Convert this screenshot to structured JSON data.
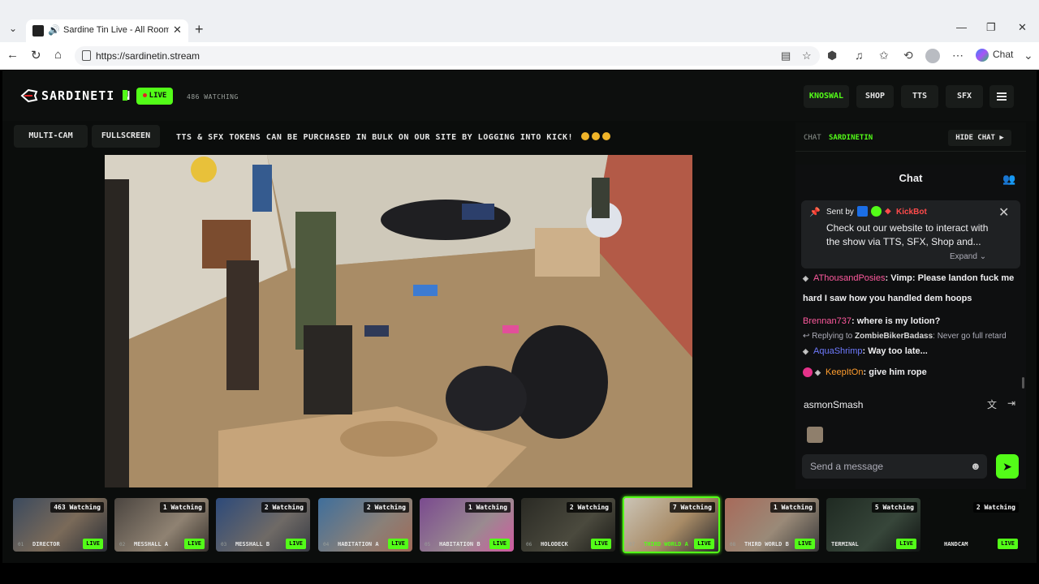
{
  "browser": {
    "tab_title": "Sardine Tin Live - All Rooms, /",
    "url": "https://sardinetin.stream",
    "chat_label": "Chat"
  },
  "header": {
    "logo_text": "SARDINETI N",
    "live_label": "LIVE",
    "watching": "486 WATCHING",
    "buttons": [
      "KNOSWAL",
      "SHOP",
      "TTS",
      "SFX"
    ]
  },
  "toolbar": {
    "multi_cam": "MULTI-CAM",
    "fullscreen": "FULLSCREEN",
    "ticker": "TTS & SFX TOKENS CAN BE PURCHASED IN BULK ON OUR SITE BY LOGGING INTO KICK!"
  },
  "chat": {
    "strip_label": "CHAT",
    "strip_channel": "SARDINETIN",
    "hide_chat": "HIDE CHAT ▶",
    "title": "Chat",
    "pinned": {
      "sent_by": "Sent by",
      "bot_name": "KickBot",
      "text": "Check out our website to interact with the show via TTS, SFX, Shop and...",
      "expand": "Expand"
    },
    "messages": [
      {
        "user": "AThousandPosies",
        "color": "#ff5a9e",
        "text": "Vimp: Please landon fuck me hard I saw how you handled dem hoops"
      },
      {
        "user": "Brennan737",
        "color": "#ff5a9e",
        "text": "where is my lotion?"
      },
      {
        "user": "AquaShrimp",
        "color": "#6f7bff",
        "text": "Way too late..."
      },
      {
        "user": "KeepItOn",
        "color": "#ff9d2e",
        "text": "give him rope"
      }
    ],
    "reply": {
      "prefix": "Replying to",
      "user": "ZombieBikerBadass",
      "text": "Never go full retard"
    },
    "mention": "asmonSmash",
    "input_placeholder": "Send a message"
  },
  "cameras": [
    {
      "num": "01",
      "name": "DIRECTOR",
      "watching": "463 Watching",
      "live": "LIVE",
      "active": false
    },
    {
      "num": "02",
      "name": "MESSHALL A",
      "watching": "1 Watching",
      "live": "LIVE",
      "active": false
    },
    {
      "num": "03",
      "name": "MESSHALL B",
      "watching": "2 Watching",
      "live": "LIVE",
      "active": false
    },
    {
      "num": "04",
      "name": "HABITATION A",
      "watching": "2 Watching",
      "live": "LIVE",
      "active": false
    },
    {
      "num": "05",
      "name": "HABITATION B",
      "watching": "1 Watching",
      "live": "LIVE",
      "active": false
    },
    {
      "num": "06",
      "name": "HOLODECK",
      "watching": "2 Watching",
      "live": "LIVE",
      "active": false
    },
    {
      "num": "07",
      "name": "THIRD WORLD A",
      "watching": "7 Watching",
      "live": "LIVE",
      "active": true
    },
    {
      "num": "08",
      "name": "THIRD WORLD B",
      "watching": "1 Watching",
      "live": "LIVE",
      "active": false
    },
    {
      "num": "",
      "name": "TERMINAL",
      "watching": "5 Watching",
      "live": "LIVE",
      "active": false
    },
    {
      "num": "",
      "name": "HANDCAM",
      "watching": "2 Watching",
      "live": "LIVE",
      "active": false
    }
  ],
  "colors": {
    "accent": "#53fc18",
    "background": "#0b0d0c",
    "bot_red": "#ff4b4b"
  }
}
